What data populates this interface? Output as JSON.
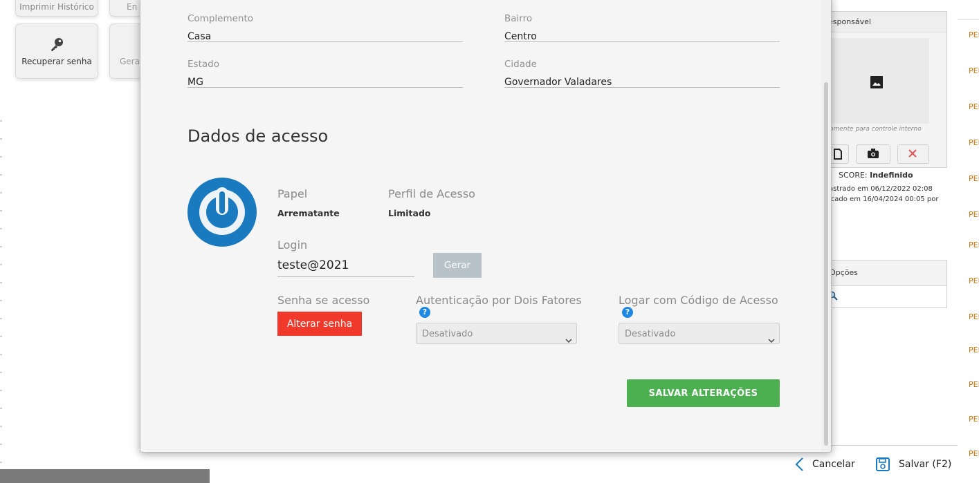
{
  "background_left": {
    "tiles": [
      {
        "label": "Imprimir Histórico"
      },
      {
        "label": "En"
      },
      {
        "label": "Recuperar senha"
      },
      {
        "label": "Gerar"
      }
    ]
  },
  "background_right": {
    "responsavel_header": "esponsável",
    "photo_note": "omente para controle interno",
    "score_label": "SCORE:",
    "score_value": "Indefinido",
    "cadastrado": "astrado em 06/12/2022 02:08",
    "modificado": "icado em 16/04/2024 00:05 por",
    "opcoes_header": "Opções",
    "edge_text": "PEN",
    "footer": {
      "cancel_label": "Cancelar",
      "save_label": "Salvar (F2)"
    }
  },
  "modal": {
    "address": {
      "complemento_label": "Complemento",
      "complemento_value": "Casa",
      "bairro_label": "Bairro",
      "bairro_value": "Centro",
      "estado_label": "Estado",
      "estado_value": "MG",
      "cidade_label": "Cidade",
      "cidade_value": "Governador Valadares"
    },
    "access": {
      "title": "Dados de acesso",
      "papel_label": "Papel",
      "papel_value": "Arrematante",
      "perfil_label": "Perfil de Acesso",
      "perfil_value": "Limitado",
      "login_label": "Login",
      "login_value": "teste@2021",
      "gerar_label": "Gerar",
      "senha_label": "Senha se acesso",
      "alterar_senha_label": "Alterar senha",
      "dois_fatores_label": "Autenticação por Dois Fatores",
      "dois_fatores_value": "Desativado",
      "codigo_label": "Logar com Código de Acesso",
      "codigo_value": "Desativado",
      "help_glyph": "?",
      "save_changes_label": "SALVAR ALTERAÇÕES"
    }
  },
  "colors": {
    "accent_blue": "#1a7abf",
    "danger_red": "#f0392b",
    "success_green": "#4caf50",
    "disabled_grey": "#b7c2c9",
    "edge_text": "#c8720a"
  }
}
